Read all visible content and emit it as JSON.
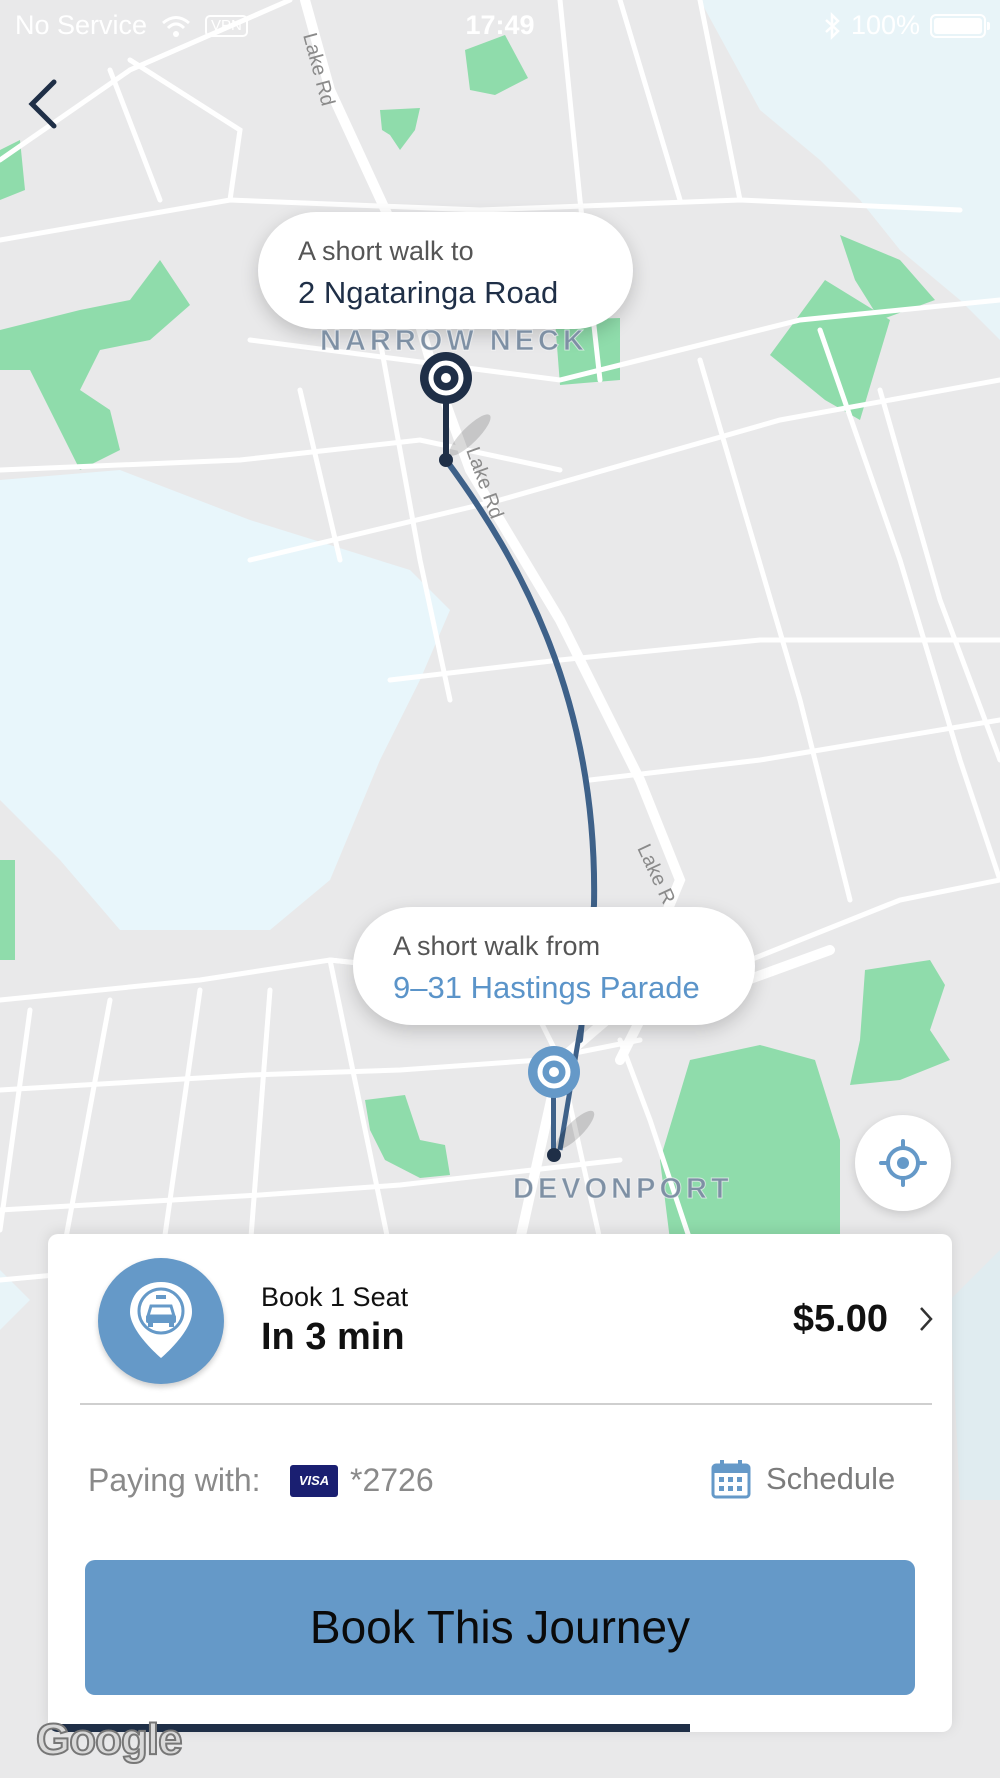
{
  "status_bar": {
    "carrier": "No Service",
    "vpn": "VPN",
    "time": "17:49",
    "battery": "100%"
  },
  "map": {
    "pickup_bubble": {
      "line1": "A short walk to",
      "line2": "2 Ngataringa Road"
    },
    "dropoff_bubble": {
      "line1": "A short walk from",
      "line2": "9–31 Hastings Parade"
    },
    "place_labels": {
      "top": "NARROW NECK",
      "bottom": "DEVONPORT"
    },
    "road_labels": [
      "Lake Rd",
      "Lake Rd",
      "Lake R"
    ],
    "attribution": "Google"
  },
  "booking": {
    "seat_label": "Book 1 Seat",
    "eta": "In 3 min",
    "price": "$5.00",
    "paying_with_label": "Paying with:",
    "card_brand": "VISA",
    "card_last4": "*2726",
    "schedule_label": "Schedule",
    "book_button": "Book This Journey",
    "progress": 0.71
  },
  "colors": {
    "accent": "#6599c8",
    "route": "#3e6189",
    "pin_dark": "#1f2f47",
    "park": "#8fdcab",
    "water": "#e8f6fb",
    "land": "#e9e9ea"
  },
  "icons": [
    "wifi-icon",
    "bluetooth-icon",
    "back-chevron-icon",
    "locate-icon",
    "taxi-pin-icon",
    "chevron-right-icon",
    "calendar-icon"
  ]
}
